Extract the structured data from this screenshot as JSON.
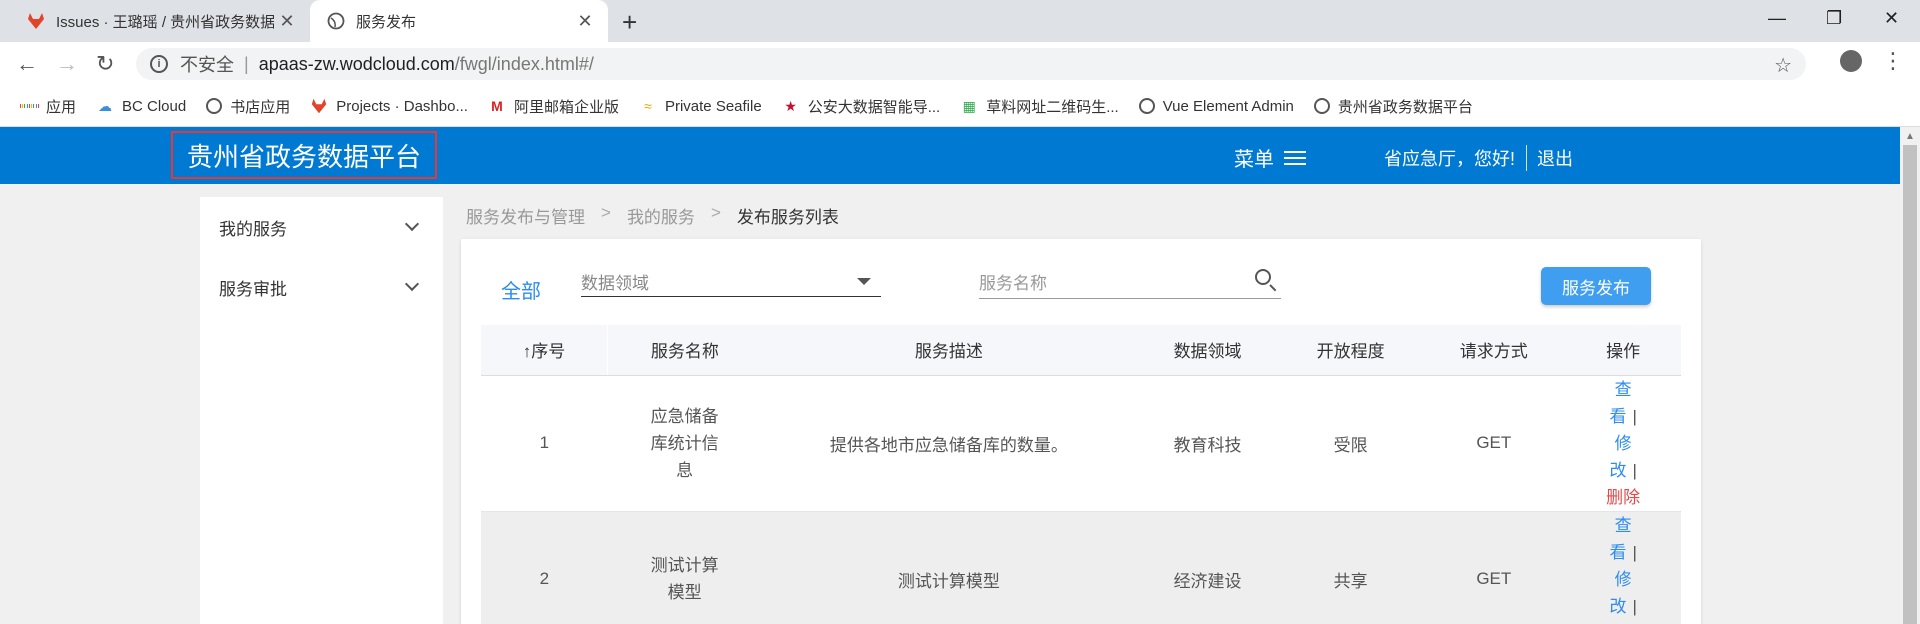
{
  "browser": {
    "tabs": [
      {
        "title": "Issues · 王璐瑶 / 贵州省政务数据",
        "active": false
      },
      {
        "title": "服务发布",
        "active": true
      }
    ],
    "not_secure": "不安全",
    "url_host": "apaas-zw.wodcloud.com",
    "url_path": "/fwgl/index.html#/",
    "bookmarks": [
      "应用",
      "BC Cloud",
      "书店应用",
      "Projects · Dashbo...",
      "阿里邮箱企业版",
      "Private Seafile",
      "公安大数据智能导...",
      "草料网址二维码生...",
      "Vue Element Admin",
      "贵州省政务数据平台"
    ]
  },
  "header": {
    "brand": "贵州省政务数据平台",
    "menu": "菜单",
    "greeting": "省应急厅，您好!",
    "logout": "退出",
    "color": "#0079d3"
  },
  "sidebar": {
    "items": [
      "我的服务",
      "服务审批"
    ]
  },
  "breadcrumb": [
    "服务发布与管理",
    "我的服务",
    "发布服务列表"
  ],
  "breadcrumb_sep": ">",
  "filters": {
    "all": "全部",
    "domain_placeholder": "数据领域",
    "name_placeholder": "服务名称",
    "publish_button": "服务发布"
  },
  "table": {
    "sort_arrow": "↑",
    "columns": [
      "序号",
      "服务名称",
      "服务描述",
      "数据领域",
      "开放程度",
      "请求方式",
      "操作"
    ],
    "rows": [
      {
        "index": "1",
        "name": "应急储备库统计信息",
        "desc": "提供各地市应急储备库的数量。",
        "domain": "教育科技",
        "openness": "受限",
        "method": "GET"
      },
      {
        "index": "2",
        "name": "测试计算模型",
        "desc": "测试计算模型",
        "domain": "经济建设",
        "openness": "共享",
        "method": "GET"
      }
    ],
    "ops": {
      "view": "查看",
      "edit": "修改",
      "delete": "删除",
      "sep": "|"
    }
  }
}
